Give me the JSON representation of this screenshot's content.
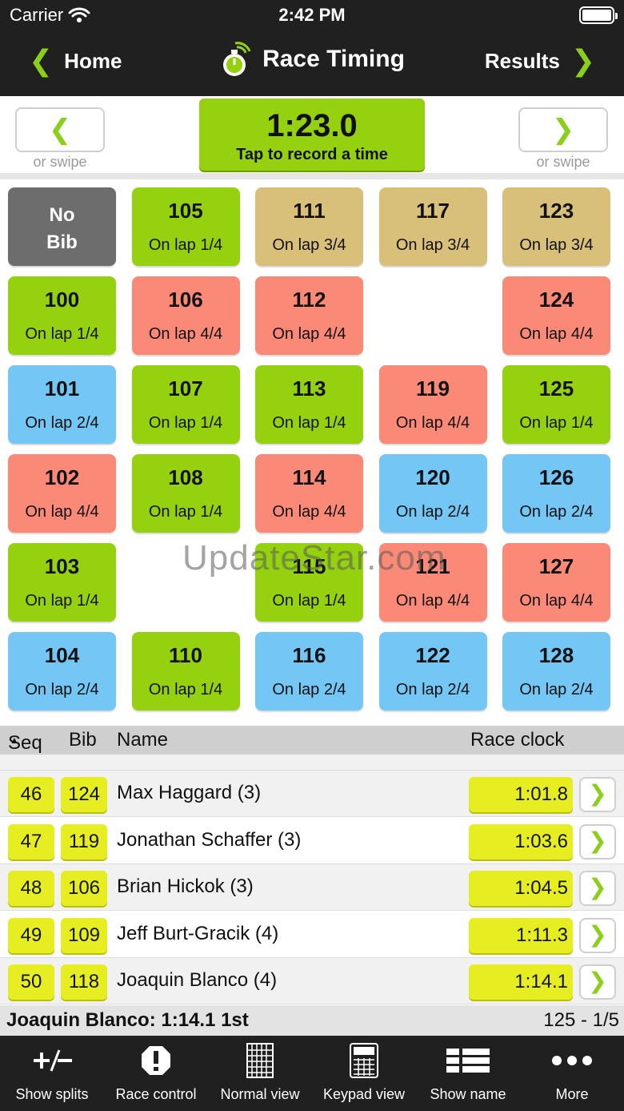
{
  "status": {
    "carrier": "Carrier",
    "time": "2:42 PM"
  },
  "nav": {
    "back_label": "Home",
    "title": "Race Timing",
    "forward_label": "Results"
  },
  "timer": {
    "time": "1:23.0",
    "label": "Tap to record a time",
    "swipe_hint_left": "or swipe",
    "swipe_hint_right": "or swipe"
  },
  "grid": {
    "no_bib_line1": "No",
    "no_bib_line2": "Bib",
    "tiles": [
      {
        "bib": "105",
        "lap": "On lap 1/4",
        "color": "#95d10e"
      },
      {
        "bib": "111",
        "lap": "On lap 3/4",
        "color": "#d8c07a"
      },
      {
        "bib": "117",
        "lap": "On lap 3/4",
        "color": "#d8c07a"
      },
      {
        "bib": "123",
        "lap": "On lap 3/4",
        "color": "#d8c07a"
      },
      {
        "bib": "100",
        "lap": "On lap 1/4",
        "color": "#95d10e"
      },
      {
        "bib": "106",
        "lap": "On lap 4/4",
        "color": "#fa8a77"
      },
      {
        "bib": "112",
        "lap": "On lap 4/4",
        "color": "#fa8a77"
      },
      {
        "bib": "124",
        "lap": "On lap 4/4",
        "color": "#fa8a77"
      },
      {
        "bib": "101",
        "lap": "On lap 2/4",
        "color": "#74c6f4"
      },
      {
        "bib": "107",
        "lap": "On lap 1/4",
        "color": "#95d10e"
      },
      {
        "bib": "113",
        "lap": "On lap 1/4",
        "color": "#95d10e"
      },
      {
        "bib": "119",
        "lap": "On lap 4/4",
        "color": "#fa8a77"
      },
      {
        "bib": "125",
        "lap": "On lap 1/4",
        "color": "#95d10e"
      },
      {
        "bib": "102",
        "lap": "On lap 4/4",
        "color": "#fa8a77"
      },
      {
        "bib": "108",
        "lap": "On lap 1/4",
        "color": "#95d10e"
      },
      {
        "bib": "114",
        "lap": "On lap 4/4",
        "color": "#fa8a77"
      },
      {
        "bib": "120",
        "lap": "On lap 2/4",
        "color": "#74c6f4"
      },
      {
        "bib": "126",
        "lap": "On lap 2/4",
        "color": "#74c6f4"
      },
      {
        "bib": "103",
        "lap": "On lap 1/4",
        "color": "#95d10e"
      },
      {
        "bib": "115",
        "lap": "On lap 1/4",
        "color": "#95d10e"
      },
      {
        "bib": "121",
        "lap": "On lap 4/4",
        "color": "#fa8a77"
      },
      {
        "bib": "127",
        "lap": "On lap 4/4",
        "color": "#fa8a77"
      },
      {
        "bib": "104",
        "lap": "On lap 2/4",
        "color": "#74c6f4"
      },
      {
        "bib": "110",
        "lap": "On lap 1/4",
        "color": "#95d10e"
      },
      {
        "bib": "116",
        "lap": "On lap 2/4",
        "color": "#74c6f4"
      },
      {
        "bib": "122",
        "lap": "On lap 2/4",
        "color": "#74c6f4"
      },
      {
        "bib": "128",
        "lap": "On lap 2/4",
        "color": "#74c6f4"
      }
    ]
  },
  "watermark": "UpdateStar.com",
  "table": {
    "headers": {
      "seq": "Seq",
      "bib": "Bib",
      "name": "Name",
      "clock": "Race clock"
    },
    "rows": [
      {
        "seq": "46",
        "bib": "124",
        "name": "Max Haggard (3)",
        "time": "1:01.8"
      },
      {
        "seq": "47",
        "bib": "119",
        "name": "Jonathan Schaffer (3)",
        "time": "1:03.6"
      },
      {
        "seq": "48",
        "bib": "106",
        "name": "Brian Hickok (3)",
        "time": "1:04.5"
      },
      {
        "seq": "49",
        "bib": "109",
        "name": "Jeff Burt-Gracik (4)",
        "time": "1:11.3"
      },
      {
        "seq": "50",
        "bib": "118",
        "name": "Joaquin Blanco (4)",
        "time": "1:14.1"
      }
    ]
  },
  "summary": {
    "left": "Joaquin Blanco: 1:14.1 1st",
    "right": "125 - 1/5"
  },
  "toolbar": {
    "items": [
      {
        "label": "Show splits",
        "icon": "plus-minus-icon"
      },
      {
        "label": "Race control",
        "icon": "alert-octagon-icon"
      },
      {
        "label": "Normal view",
        "icon": "grid-icon"
      },
      {
        "label": "Keypad view",
        "icon": "keypad-icon"
      },
      {
        "label": "Show name",
        "icon": "list-icon"
      },
      {
        "label": "More",
        "icon": "more-dots-icon"
      }
    ]
  }
}
